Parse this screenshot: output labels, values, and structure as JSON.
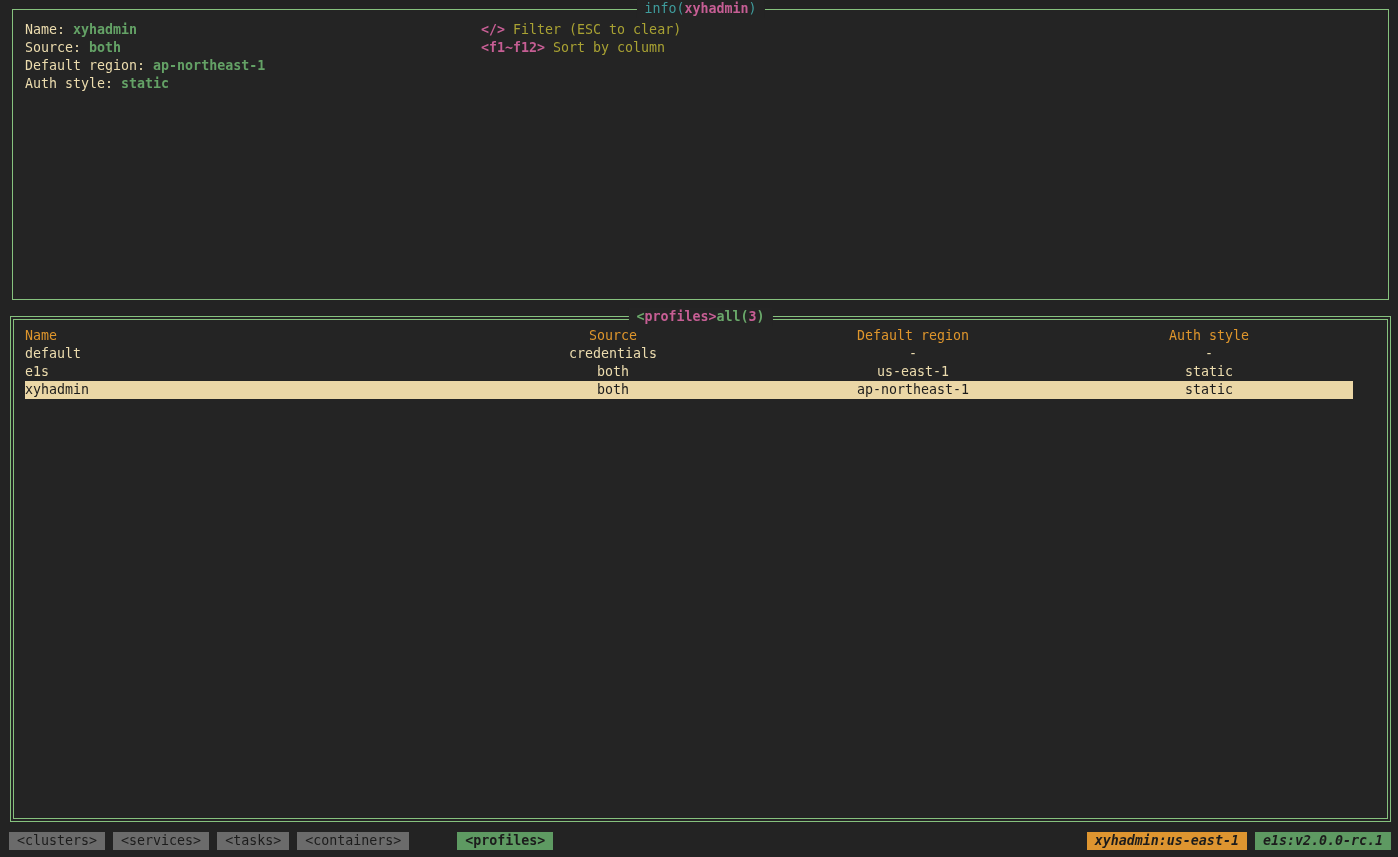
{
  "info_panel": {
    "title": [
      {
        "text": "info(",
        "kind": "label"
      },
      {
        "text": "xyhadmin",
        "kind": "accent"
      },
      {
        "text": ")",
        "kind": "label"
      }
    ],
    "fields": [
      {
        "label": "Name:",
        "value": "xyhadmin"
      },
      {
        "label": "Source:",
        "value": "both"
      },
      {
        "label": "Default region:",
        "value": "ap-northeast-1"
      },
      {
        "label": "Auth style:",
        "value": "static"
      }
    ],
    "hints": [
      {
        "key": "</>",
        "description": "Filter (ESC to clear)"
      },
      {
        "key": "<f1~f12>",
        "description": "Sort by column"
      }
    ]
  },
  "profiles_panel": {
    "title": [
      {
        "text": "<",
        "kind": "filter"
      },
      {
        "text": "profiles>",
        "kind": "accent"
      },
      {
        "text": "all(",
        "kind": "filter"
      },
      {
        "text": "3",
        "kind": "accent"
      },
      {
        "text": ")",
        "kind": "filter"
      }
    ],
    "table": {
      "columns": [
        {
          "label": "Name",
          "kind": "left"
        },
        {
          "label": "Source",
          "kind": "center"
        },
        {
          "label": "Default region",
          "kind": "center"
        },
        {
          "label": "Auth style",
          "kind": "center"
        }
      ],
      "rows": [
        {
          "cells": [
            "default",
            "credentials",
            "-",
            "-"
          ],
          "selected": false
        },
        {
          "cells": [
            "e1s",
            "both",
            "us-east-1",
            "static"
          ],
          "selected": false
        },
        {
          "cells": [
            "xyhadmin",
            "both",
            "ap-northeast-1",
            "static"
          ],
          "selected": true
        }
      ]
    }
  },
  "status_bar": {
    "tabs": [
      {
        "label": "<clusters>",
        "selected": false
      },
      {
        "label": "<services>",
        "selected": false
      },
      {
        "label": "<tasks>",
        "selected": false
      },
      {
        "label": "<containers>",
        "selected": false
      },
      {
        "label": "<profiles>",
        "selected": true
      }
    ],
    "badges": [
      {
        "text": "xyhadmin:us-east-1",
        "color": "#de9530"
      },
      {
        "text": "e1s:v2.0.0-rc.1",
        "color": "#5e9a62"
      }
    ]
  }
}
